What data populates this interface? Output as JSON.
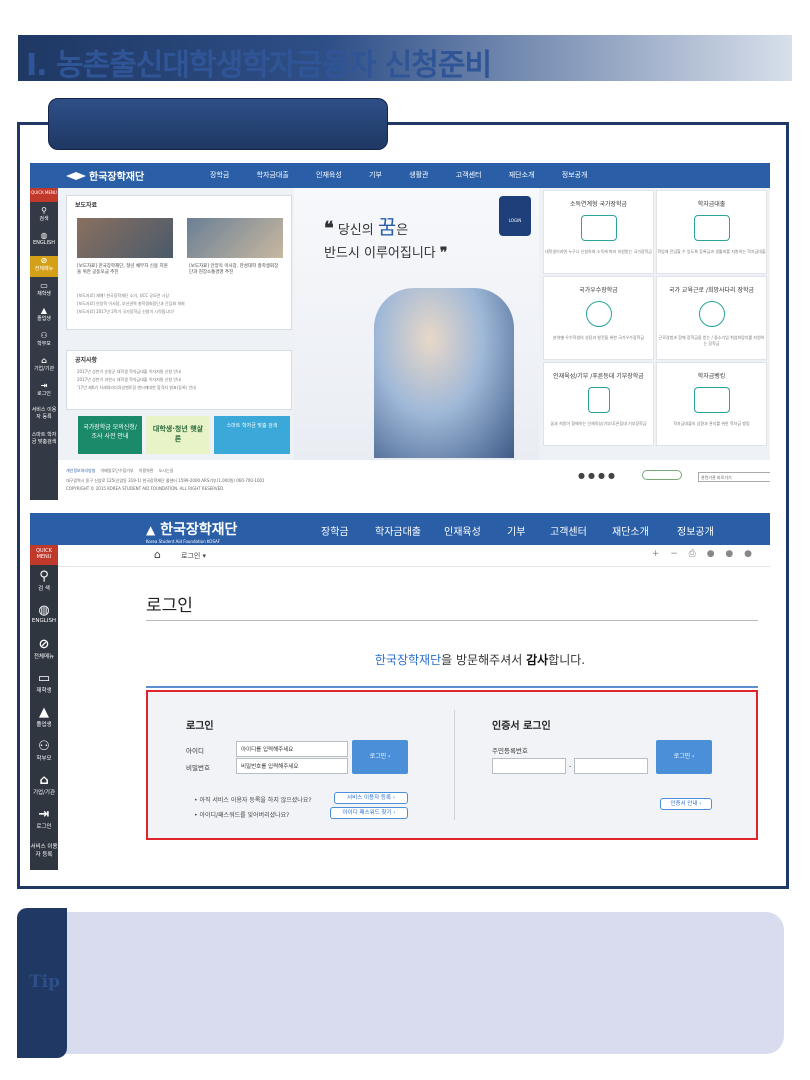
{
  "doc": {
    "title": "I. 농촌출신대학생학자금융자 신청준비",
    "tip_label": "Tip"
  },
  "home": {
    "logo": "한국장학재단",
    "nav": [
      "장학금",
      "학자금대출",
      "인재육성",
      "기부",
      "생활관",
      "고객센터",
      "재단소개",
      "정보공개"
    ],
    "quick_menu": "QUICK MENU",
    "quick_items": [
      "검색",
      "ENGLISH",
      "전체메뉴",
      "재학생",
      "졸업생",
      "학부모",
      "기업/기관",
      "로그인",
      "서비스 이용자 등록",
      "스마트 학자금 맞춤검색"
    ],
    "press_title": "보도자료",
    "press_captions": [
      "[보도자료] 한국장학재단, 청년 채무자 신용 지원을 위한 공동모금 추진",
      "[보도자료] 안양옥 이사장, 한성대학 총학생회장단과 현장소통경영 추진"
    ],
    "press_list": [
      "[보도자료] 재해! 한국장학재단 소기, UCC 공모전 시상",
      "[보도자료] 안양옥 이사장, 부산권역 총학생회장단과 간담회 개최",
      "[보도자료] 2017년 2학기 국가장학금 신청이 시작됩니다!"
    ],
    "notice_title": "공지사항",
    "notice_list": [
      "2017년 상반기 순창군 대학생 학자금대출 이자지원 신청 안내",
      "2017년 상반기 과천시 대학생 학자금대출 이자지원 신청 안내",
      "'17년 제6기 차세대리더육성멘토링 멘티에대한 합격자 발표(등록) 안내"
    ],
    "banners": [
      "국가장학금 모의신청/조사 사전 안내",
      "대학생·청년 햇살론",
      "스마트 학자금 맞춤 검색"
    ],
    "hero_quote_1": "당신의",
    "hero_quote_em": "꿈",
    "hero_quote_2": "은",
    "hero_quote_3": "반드시 이루어집니다",
    "login_badge": "LOGIN",
    "cells": [
      {
        "title": "소득연계형 국가장학금",
        "desc": "대학생이라면 누구나 신청하여 소득에 따라 지원받는 국가장학금"
      },
      {
        "title": "학자금대출",
        "desc": "학업에 전념할 수 있도록 등록금과 생활비를 지원하는 학자금대출"
      },
      {
        "title": "국가우수장학금",
        "desc": "분야별 우수학생의 성장과 발전을 위한 국가우수장학금"
      },
      {
        "title": "국가 교육근로 /희망사다리 장학금",
        "desc": "근로경험과 함께 장학금을 받는 / 중소기업 취업희망자를 지원하는 장학금"
      },
      {
        "title": "인재육성/기부 /푸른등대 기부장학금",
        "desc": "꿈과 희망이 함께하는 인재육성/기부/푸른등대 기부장학금"
      },
      {
        "title": "학자금뱅킹",
        "desc": "학자금대출의 상환과 관리를 위한 학자금 뱅킹"
      }
    ],
    "footer_links": [
      "개인정보처리방침",
      "이메일무단수집거부",
      "이용약관",
      "오시는길"
    ],
    "footer_addr": "대구광역시 동구 신암로 125(신암동 319-1) 한국장학재단 콜센터 1599-2000 ARS기부(1,000원) 060-700-1001",
    "footer_copy": "COPYRIGHT © 2015 KOREA STUDENT AID FOUNDATION. ALL RIGHT RESERVED.",
    "family_site": "관련기관 바로가기",
    "go": "GO"
  },
  "login_page": {
    "logo": "한국장학재단",
    "logo_sub": "Korea Student Aid Foundation KOSAF",
    "nav": [
      "장학금",
      "학자금대출",
      "인재육성",
      "기부",
      "고객센터",
      "재단소개",
      "정보공개"
    ],
    "quick_menu": "QUICK MENU",
    "quick_items": [
      "검 색",
      "ENGLISH",
      "전체메뉴",
      "재학생",
      "졸업생",
      "학부모",
      "기업/기관",
      "로그인",
      "서비스 이용자 등록"
    ],
    "breadcrumb": "로그인",
    "page_title": "로그인",
    "welcome_brand": "한국장학재단",
    "welcome_mid": "을 방문해주셔서 ",
    "welcome_bold": "감사",
    "welcome_end": "합니다.",
    "login_heading": "로그인",
    "id_label": "아이디",
    "pw_label": "비밀번호",
    "id_placeholder": "아이디를 입력해주세요",
    "pw_placeholder": "비밀번호를 입력해주세요",
    "login_button": "로그인",
    "note_register": "• 아직 서비스 이용자 등록을 하지 않으셨나요?",
    "register_button": "서비스 이용자 등록",
    "note_find": "• 아이디/패스워드를 잊어버리셨나요?",
    "find_button": "아이디 패스워드 찾기",
    "cert_heading": "인증서 로그인",
    "rrn_label": "주민등록번호",
    "cert_login_button": "로그인",
    "cert_guide_button": "인증서 안내",
    "dash": "-"
  }
}
